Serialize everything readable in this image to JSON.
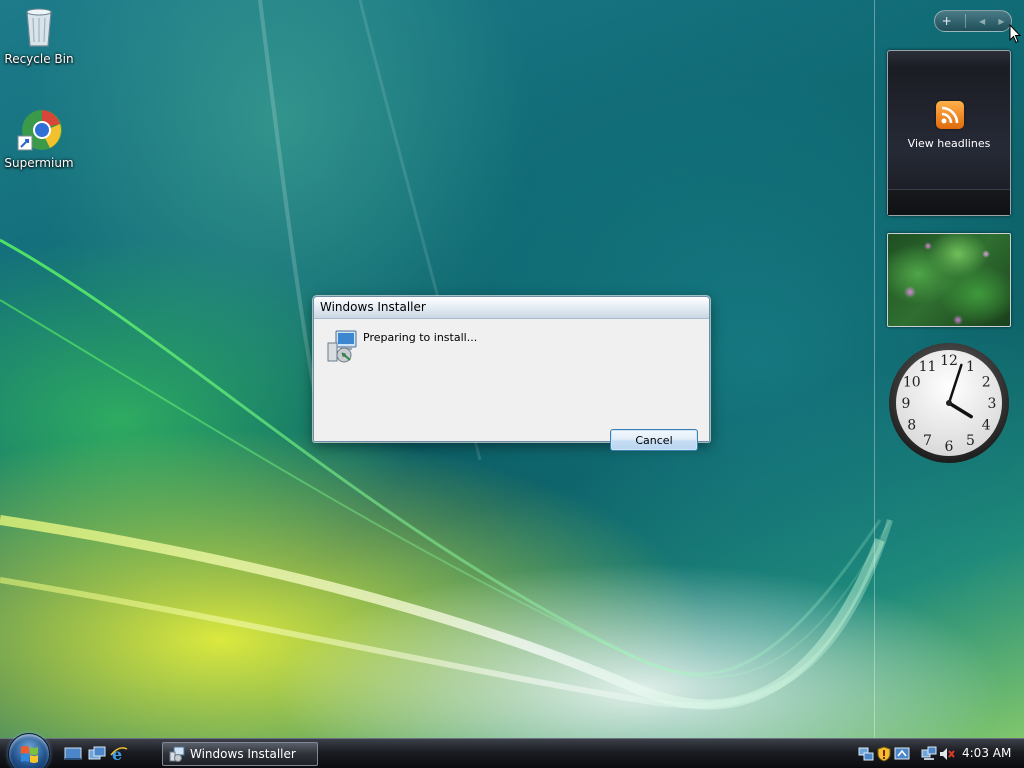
{
  "desktop": {
    "icons": [
      {
        "label": "Recycle Bin",
        "icon": "recycle-bin-icon"
      },
      {
        "label": "Supermium",
        "icon": "supermium-browser-icon"
      }
    ]
  },
  "sidebar": {
    "controls": {
      "add": "+",
      "prev": "◂",
      "next": "▸"
    },
    "feed_gadget": {
      "label": "View headlines",
      "icon": "rss-feed-icon"
    },
    "clock_gadget": {
      "numerals": [
        "12",
        "1",
        "2",
        "3",
        "4",
        "5",
        "6",
        "7",
        "8",
        "9",
        "10",
        "11"
      ],
      "time": {
        "hour": 4,
        "minute": 3
      }
    }
  },
  "dialog": {
    "title": "Windows Installer",
    "message": "Preparing to install...",
    "cancel_label": "Cancel"
  },
  "taskbar": {
    "task_label": "Windows Installer",
    "clock": "4:03 AM"
  },
  "colors": {
    "dialog_border": "#6f8ca8",
    "button_border": "#3c7fb1",
    "taskbar": "#1a1c21"
  }
}
